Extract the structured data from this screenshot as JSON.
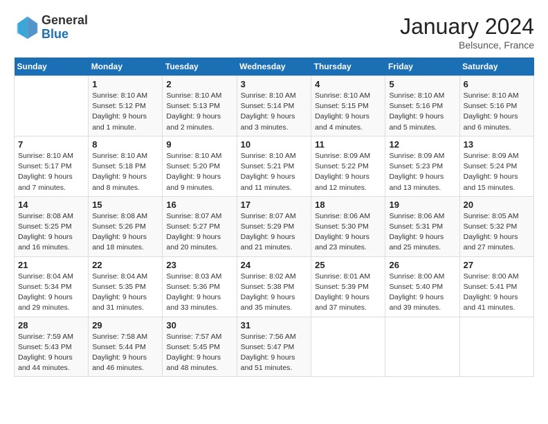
{
  "header": {
    "logo_general": "General",
    "logo_blue": "Blue",
    "month_year": "January 2024",
    "location": "Belsunce, France"
  },
  "weekdays": [
    "Sunday",
    "Monday",
    "Tuesday",
    "Wednesday",
    "Thursday",
    "Friday",
    "Saturday"
  ],
  "weeks": [
    [
      {
        "day": "",
        "info": ""
      },
      {
        "day": "1",
        "info": "Sunrise: 8:10 AM\nSunset: 5:12 PM\nDaylight: 9 hours\nand 1 minute."
      },
      {
        "day": "2",
        "info": "Sunrise: 8:10 AM\nSunset: 5:13 PM\nDaylight: 9 hours\nand 2 minutes."
      },
      {
        "day": "3",
        "info": "Sunrise: 8:10 AM\nSunset: 5:14 PM\nDaylight: 9 hours\nand 3 minutes."
      },
      {
        "day": "4",
        "info": "Sunrise: 8:10 AM\nSunset: 5:15 PM\nDaylight: 9 hours\nand 4 minutes."
      },
      {
        "day": "5",
        "info": "Sunrise: 8:10 AM\nSunset: 5:16 PM\nDaylight: 9 hours\nand 5 minutes."
      },
      {
        "day": "6",
        "info": "Sunrise: 8:10 AM\nSunset: 5:16 PM\nDaylight: 9 hours\nand 6 minutes."
      }
    ],
    [
      {
        "day": "7",
        "info": "Sunrise: 8:10 AM\nSunset: 5:17 PM\nDaylight: 9 hours\nand 7 minutes."
      },
      {
        "day": "8",
        "info": "Sunrise: 8:10 AM\nSunset: 5:18 PM\nDaylight: 9 hours\nand 8 minutes."
      },
      {
        "day": "9",
        "info": "Sunrise: 8:10 AM\nSunset: 5:20 PM\nDaylight: 9 hours\nand 9 minutes."
      },
      {
        "day": "10",
        "info": "Sunrise: 8:10 AM\nSunset: 5:21 PM\nDaylight: 9 hours\nand 11 minutes."
      },
      {
        "day": "11",
        "info": "Sunrise: 8:09 AM\nSunset: 5:22 PM\nDaylight: 9 hours\nand 12 minutes."
      },
      {
        "day": "12",
        "info": "Sunrise: 8:09 AM\nSunset: 5:23 PM\nDaylight: 9 hours\nand 13 minutes."
      },
      {
        "day": "13",
        "info": "Sunrise: 8:09 AM\nSunset: 5:24 PM\nDaylight: 9 hours\nand 15 minutes."
      }
    ],
    [
      {
        "day": "14",
        "info": "Sunrise: 8:08 AM\nSunset: 5:25 PM\nDaylight: 9 hours\nand 16 minutes."
      },
      {
        "day": "15",
        "info": "Sunrise: 8:08 AM\nSunset: 5:26 PM\nDaylight: 9 hours\nand 18 minutes."
      },
      {
        "day": "16",
        "info": "Sunrise: 8:07 AM\nSunset: 5:27 PM\nDaylight: 9 hours\nand 20 minutes."
      },
      {
        "day": "17",
        "info": "Sunrise: 8:07 AM\nSunset: 5:29 PM\nDaylight: 9 hours\nand 21 minutes."
      },
      {
        "day": "18",
        "info": "Sunrise: 8:06 AM\nSunset: 5:30 PM\nDaylight: 9 hours\nand 23 minutes."
      },
      {
        "day": "19",
        "info": "Sunrise: 8:06 AM\nSunset: 5:31 PM\nDaylight: 9 hours\nand 25 minutes."
      },
      {
        "day": "20",
        "info": "Sunrise: 8:05 AM\nSunset: 5:32 PM\nDaylight: 9 hours\nand 27 minutes."
      }
    ],
    [
      {
        "day": "21",
        "info": "Sunrise: 8:04 AM\nSunset: 5:34 PM\nDaylight: 9 hours\nand 29 minutes."
      },
      {
        "day": "22",
        "info": "Sunrise: 8:04 AM\nSunset: 5:35 PM\nDaylight: 9 hours\nand 31 minutes."
      },
      {
        "day": "23",
        "info": "Sunrise: 8:03 AM\nSunset: 5:36 PM\nDaylight: 9 hours\nand 33 minutes."
      },
      {
        "day": "24",
        "info": "Sunrise: 8:02 AM\nSunset: 5:38 PM\nDaylight: 9 hours\nand 35 minutes."
      },
      {
        "day": "25",
        "info": "Sunrise: 8:01 AM\nSunset: 5:39 PM\nDaylight: 9 hours\nand 37 minutes."
      },
      {
        "day": "26",
        "info": "Sunrise: 8:00 AM\nSunset: 5:40 PM\nDaylight: 9 hours\nand 39 minutes."
      },
      {
        "day": "27",
        "info": "Sunrise: 8:00 AM\nSunset: 5:41 PM\nDaylight: 9 hours\nand 41 minutes."
      }
    ],
    [
      {
        "day": "28",
        "info": "Sunrise: 7:59 AM\nSunset: 5:43 PM\nDaylight: 9 hours\nand 44 minutes."
      },
      {
        "day": "29",
        "info": "Sunrise: 7:58 AM\nSunset: 5:44 PM\nDaylight: 9 hours\nand 46 minutes."
      },
      {
        "day": "30",
        "info": "Sunrise: 7:57 AM\nSunset: 5:45 PM\nDaylight: 9 hours\nand 48 minutes."
      },
      {
        "day": "31",
        "info": "Sunrise: 7:56 AM\nSunset: 5:47 PM\nDaylight: 9 hours\nand 51 minutes."
      },
      {
        "day": "",
        "info": ""
      },
      {
        "day": "",
        "info": ""
      },
      {
        "day": "",
        "info": ""
      }
    ]
  ]
}
